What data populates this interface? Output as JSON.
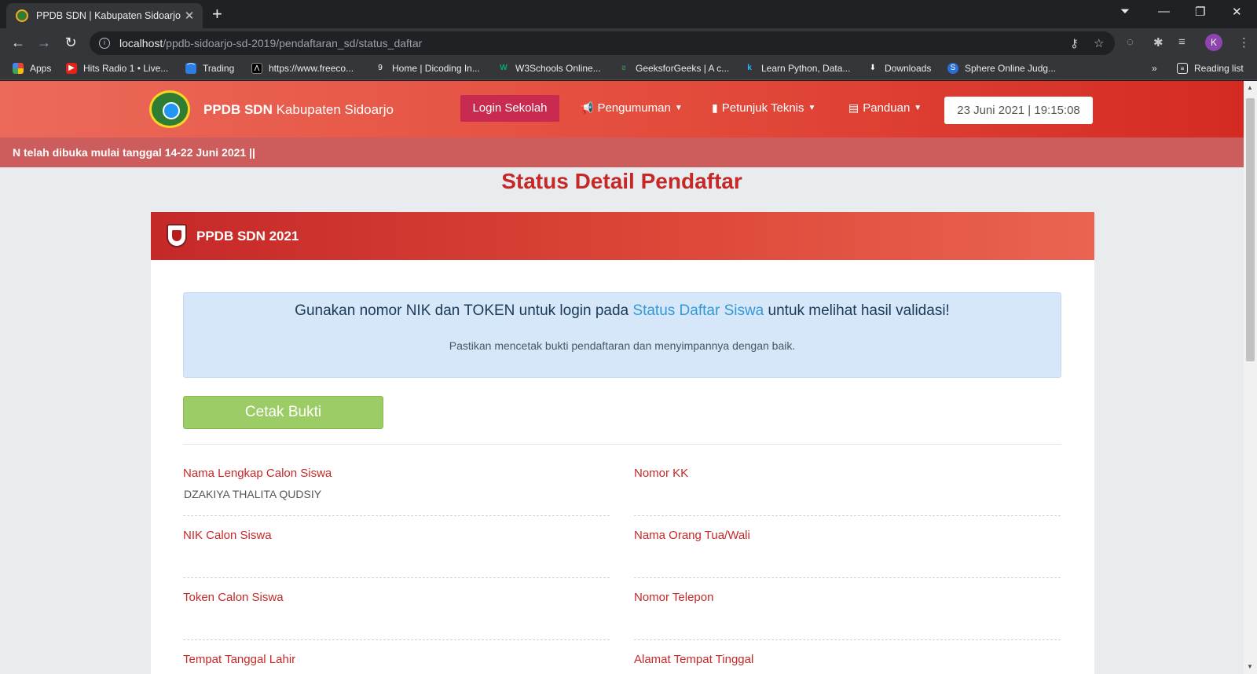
{
  "browser": {
    "tab_title": "PPDB SDN | Kabupaten Sidoarjo",
    "tab_close": "✕",
    "new_tab": "+",
    "url_host": "localhost",
    "url_path": "/ppdb-sidoarjo-sd-2019/pendaftaran_sd/status_daftar",
    "avatar_initial": "K",
    "bookmarks": [
      {
        "label": "Apps",
        "icon": "apps-grid-icon"
      },
      {
        "label": "Hits Radio 1 • Live...",
        "icon": "youtube-icon"
      },
      {
        "label": "Trading",
        "icon": "trading-icon"
      },
      {
        "label": "https://www.freeco...",
        "icon": "freecodecamp-icon"
      },
      {
        "label": "Home | Dicoding In...",
        "icon": "dicoding-icon"
      },
      {
        "label": "W3Schools Online...",
        "icon": "w3schools-icon"
      },
      {
        "label": "GeeksforGeeks | A c...",
        "icon": "geeksforgeeks-icon"
      },
      {
        "label": "Learn Python, Data...",
        "icon": "kaggle-icon"
      },
      {
        "label": "Downloads",
        "icon": "download-icon"
      },
      {
        "label": "Sphere Online Judg...",
        "icon": "spoj-icon"
      }
    ],
    "bookmarks_more": "»",
    "reading_list": "Reading list"
  },
  "site": {
    "brand_bold": "PPDB SDN",
    "brand_rest": " Kabupaten Sidoarjo",
    "login_button": "Login Sekolah",
    "menu": [
      {
        "label": "Pengumuman",
        "icon": "megaphone-icon"
      },
      {
        "label": "Petunjuk Teknis",
        "icon": "book-icon"
      },
      {
        "label": "Panduan",
        "icon": "guide-icon"
      }
    ],
    "datetime": "23 Juni 2021 | 19:15:08",
    "marquee": "N telah dibuka mulai tanggal 14-22 Juni 2021 ||"
  },
  "page": {
    "title": "Status Detail Pendaftar",
    "card_title": "PPDB SDN 2021",
    "alert": {
      "before": "Gunakan nomor NIK dan TOKEN untuk login pada ",
      "link": "Status Daftar Siswa",
      "after": " untuk melihat hasil validasi!",
      "sub": "Pastikan mencetak bukti pendaftaran dan menyimpannya dengan baik."
    },
    "print_button": "Cetak Bukti",
    "fields": [
      {
        "label": "Nama Lengkap Calon Siswa",
        "value": "DZAKIYA THALITA QUDSIY"
      },
      {
        "label": "Nomor KK",
        "value": ""
      },
      {
        "label": "NIK Calon Siswa",
        "value": ""
      },
      {
        "label": "Nama Orang Tua/Wali",
        "value": ""
      },
      {
        "label": "Token Calon Siswa",
        "value": ""
      },
      {
        "label": "Nomor Telepon",
        "value": ""
      },
      {
        "label": "Tempat Tanggal Lahir",
        "value": ""
      },
      {
        "label": "Alamat Tempat Tinggal",
        "value": ""
      }
    ]
  },
  "colors": {
    "accent_red": "#c62828",
    "login_button": "#c92a4f",
    "print_button": "#9ccc65",
    "alert_bg": "#d6e7f9",
    "alert_link": "#3399d6"
  }
}
